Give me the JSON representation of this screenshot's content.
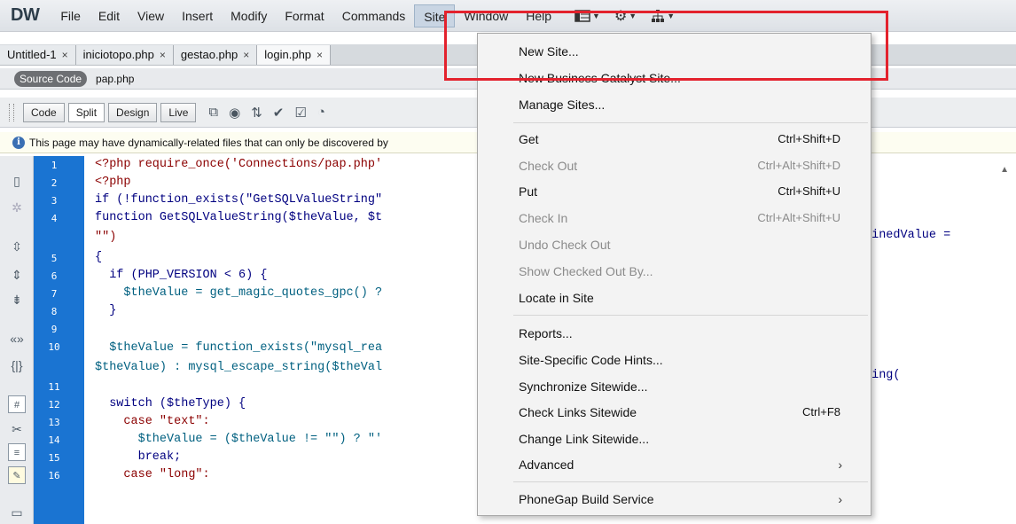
{
  "app": {
    "logo": "DW"
  },
  "menubar": {
    "items": [
      "File",
      "Edit",
      "View",
      "Insert",
      "Modify",
      "Format",
      "Commands",
      "Site",
      "Window",
      "Help"
    ],
    "active": "Site",
    "tool_icons": [
      "layout-icon",
      "gear-icon",
      "sitemap-icon"
    ]
  },
  "tabs": [
    {
      "label": "Untitled-1",
      "close": "×"
    },
    {
      "label": "iniciotopo.php",
      "close": "×"
    },
    {
      "label": "gestao.php",
      "close": "×"
    },
    {
      "label": "login.php",
      "close": "×"
    }
  ],
  "related": {
    "source_label": "Source Code",
    "file": "pap.php"
  },
  "viewbar": {
    "code": "Code",
    "split": "Split",
    "design": "Design",
    "live": "Live"
  },
  "info": {
    "text": "This page may have dynamically-related files that can only be discovered by"
  },
  "code": {
    "line_numbers": [
      "1",
      "2",
      "3",
      "4",
      "5",
      "6",
      "7",
      "8",
      "9",
      "10",
      "11",
      "12",
      "13",
      "14",
      "15",
      "16"
    ],
    "lines": [
      "<?php require_once('Connections/pap.php'",
      "<?php",
      "if (!function_exists(\"GetSQLValueString\"",
      "function GetSQLValueString($theValue, $t",
      "\"\")",
      "{",
      "  if (PHP_VERSION < 6) {",
      "    $theValue = get_magic_quotes_gpc() ?",
      "  }",
      "",
      "  $theValue = function_exists(\"mysql_rea",
      "$theValue) : mysql_escape_string($theVal",
      "",
      "  switch ($theType) {",
      "    case \"text\":",
      "      $theValue = ($theValue != \"\") ? \"'",
      "      break;",
      "    case \"long\":"
    ],
    "right_fragments": {
      "line4": "finedValue =",
      "line10": "ring("
    }
  },
  "site_menu": {
    "items": [
      {
        "label": "New Site...",
        "shortcut": "",
        "disabled": false
      },
      {
        "label": "New Business Catalyst Site...",
        "shortcut": "",
        "disabled": false
      },
      {
        "label": "Manage Sites...",
        "shortcut": "",
        "disabled": false
      },
      {
        "label": "Get",
        "shortcut": "Ctrl+Shift+D",
        "disabled": false
      },
      {
        "label": "Check Out",
        "shortcut": "Ctrl+Alt+Shift+D",
        "disabled": true
      },
      {
        "label": "Put",
        "shortcut": "Ctrl+Shift+U",
        "disabled": false
      },
      {
        "label": "Check In",
        "shortcut": "Ctrl+Alt+Shift+U",
        "disabled": true
      },
      {
        "label": "Undo Check Out",
        "shortcut": "",
        "disabled": true
      },
      {
        "label": "Show Checked Out By...",
        "shortcut": "",
        "disabled": true
      },
      {
        "label": "Locate in Site",
        "shortcut": "",
        "disabled": false
      },
      {
        "label": "Reports...",
        "shortcut": "",
        "disabled": false
      },
      {
        "label": "Site-Specific Code Hints...",
        "shortcut": "",
        "disabled": false
      },
      {
        "label": "Synchronize Sitewide...",
        "shortcut": "",
        "disabled": false
      },
      {
        "label": "Check Links Sitewide",
        "shortcut": "Ctrl+F8",
        "disabled": false
      },
      {
        "label": "Change Link Sitewide...",
        "shortcut": "",
        "disabled": false
      },
      {
        "label": "Advanced",
        "shortcut": "",
        "disabled": false,
        "submenu": true
      },
      {
        "label": "PhoneGap Build Service",
        "shortcut": "",
        "disabled": false,
        "submenu": true
      }
    ],
    "submenu_arrow": "›"
  },
  "colors": {
    "gutter": "#1a74d2",
    "highlight": "#e3222d",
    "code_keyword": "#000080",
    "code_string": "#8b0000"
  }
}
